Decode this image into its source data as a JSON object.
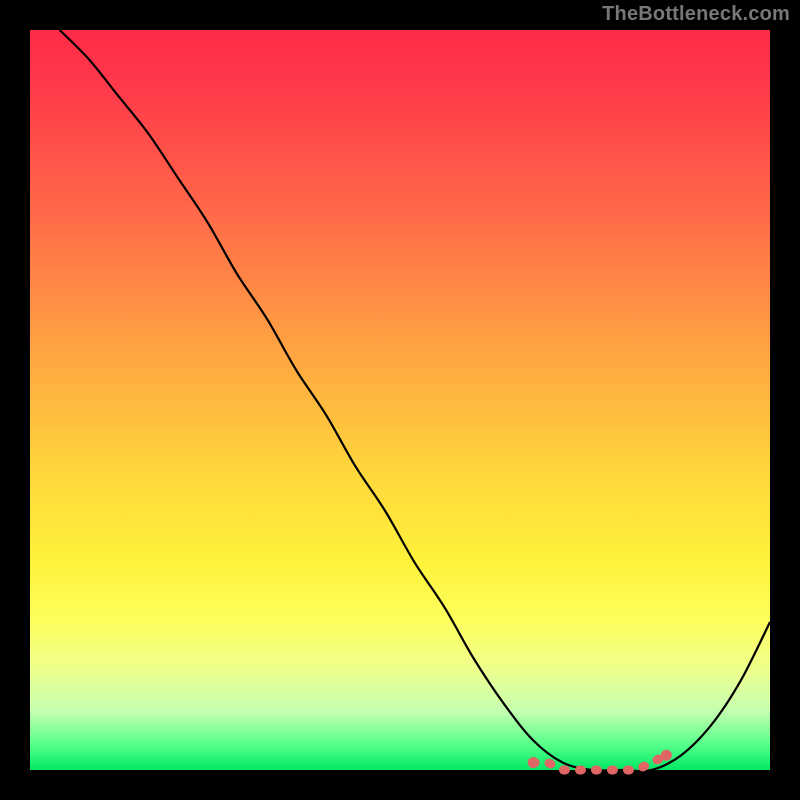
{
  "watermark": "TheBottleneck.com",
  "chart_data": {
    "type": "line",
    "title": "",
    "xlabel": "",
    "ylabel": "",
    "xlim": [
      0,
      100
    ],
    "ylim": [
      0,
      100
    ],
    "grid": false,
    "legend": false,
    "series": [
      {
        "name": "bottleneck-curve",
        "color": "#000000",
        "x": [
          4,
          8,
          12,
          16,
          20,
          24,
          28,
          32,
          36,
          40,
          44,
          48,
          52,
          56,
          60,
          64,
          68,
          72,
          76,
          80,
          84,
          88,
          92,
          96,
          100
        ],
        "y": [
          100,
          96,
          91,
          86,
          80,
          74,
          67,
          61,
          54,
          48,
          41,
          35,
          28,
          22,
          15,
          9,
          4,
          1,
          0,
          0,
          0,
          2,
          6,
          12,
          20
        ]
      },
      {
        "name": "optimal-range",
        "type": "scatter",
        "color": "#e06666",
        "x": [
          68,
          70,
          72,
          74,
          76,
          78,
          80,
          82,
          84,
          86
        ],
        "y": [
          1,
          1,
          0,
          0,
          0,
          0,
          0,
          0,
          1,
          2
        ]
      }
    ],
    "annotations": []
  }
}
